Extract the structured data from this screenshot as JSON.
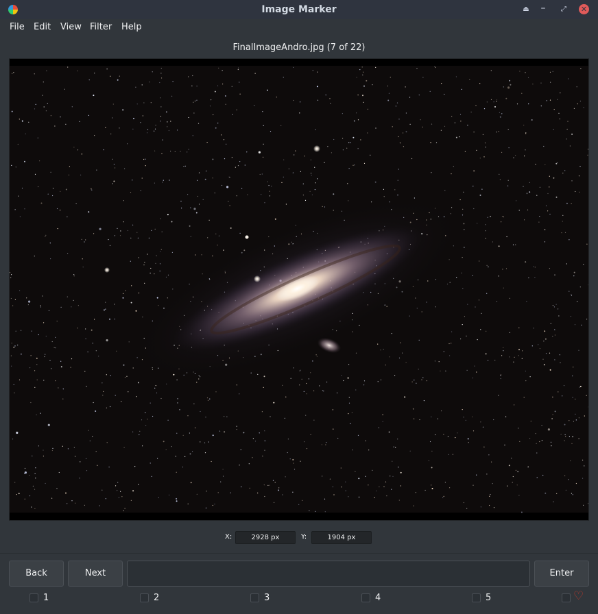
{
  "window": {
    "title": "Image Marker"
  },
  "menu": {
    "items": [
      "File",
      "Edit",
      "View",
      "Filter",
      "Help"
    ]
  },
  "image": {
    "caption": "FinalImageAndro.jpg (7 of 22)"
  },
  "coords": {
    "x_label": "X:",
    "x_value": "2928 px",
    "y_label": "Y:",
    "y_value": "1904 px"
  },
  "buttons": {
    "back": "Back",
    "next": "Next",
    "enter": "Enter"
  },
  "marks": [
    "1",
    "2",
    "3",
    "4",
    "5"
  ],
  "icons": {
    "app": "color-wheel-icon",
    "keep_above": "keep-above-icon",
    "minimize": "minimize-icon",
    "maximize": "maximize-icon",
    "close": "close-icon",
    "favorite": "heart-icon"
  }
}
